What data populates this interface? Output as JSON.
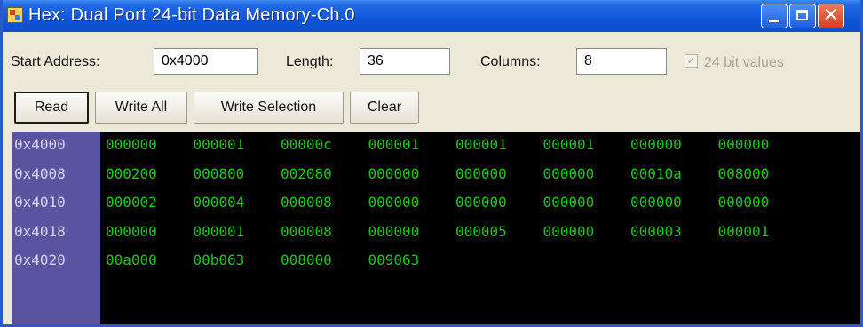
{
  "window": {
    "title": "Hex: Dual Port 24-bit Data Memory-Ch.0",
    "icon": "window-app-icon"
  },
  "controls": {
    "start_address_label": "Start Address:",
    "start_address_value": "0x4000",
    "length_label": "Length:",
    "length_value": "36",
    "columns_label": "Columns:",
    "columns_value": "8",
    "bit24_label": "24 bit values",
    "bit24_checked": true,
    "bit24_enabled": false
  },
  "buttons": {
    "read": "Read",
    "write_all": "Write All",
    "write_selection": "Write Selection",
    "clear": "Clear"
  },
  "hex": {
    "rows": [
      {
        "address": "0x4000",
        "values": [
          "000000",
          "000001",
          "00000c",
          "000001",
          "000001",
          "000001",
          "000000",
          "000000"
        ]
      },
      {
        "address": "0x4008",
        "values": [
          "000200",
          "000800",
          "002080",
          "000000",
          "000000",
          "000000",
          "00010a",
          "008000"
        ]
      },
      {
        "address": "0x4010",
        "values": [
          "000002",
          "000004",
          "000008",
          "000000",
          "000000",
          "000000",
          "000000",
          "000000"
        ]
      },
      {
        "address": "0x4018",
        "values": [
          "000000",
          "000001",
          "000008",
          "000000",
          "000005",
          "000000",
          "000003",
          "000001"
        ]
      },
      {
        "address": "0x4020",
        "values": [
          "00a000",
          "00b063",
          "008000",
          "009063"
        ]
      }
    ]
  },
  "colors": {
    "hex_text": "#1ec51e",
    "address_column": "#5a54a0",
    "title_bar": "#0f56d8"
  }
}
